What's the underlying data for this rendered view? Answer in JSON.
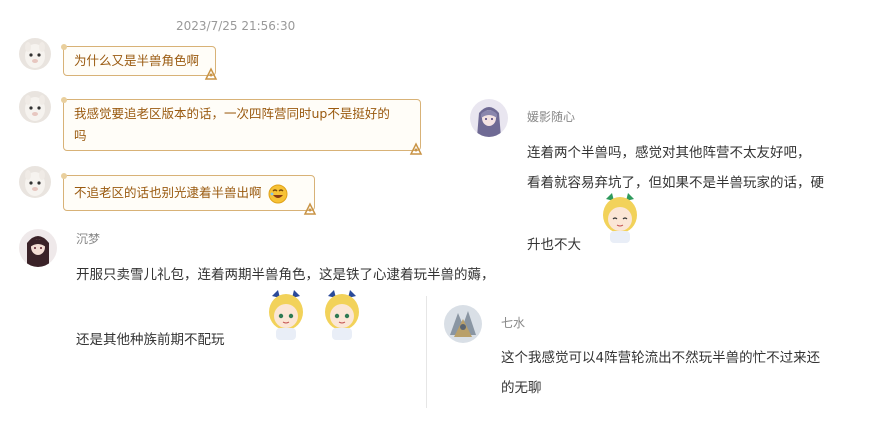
{
  "timestamp": "2023/7/25 21:56:30",
  "chat_bubbles": [
    {
      "text": "为什么又是半兽角色啊"
    },
    {
      "text_line1": "我感觉要追老区版本的话，一次四阵营同时up不是挺好的",
      "text_line2": "吗"
    },
    {
      "text": "不追老区的话也别光逮着半兽出啊"
    }
  ],
  "comments": [
    {
      "username": "沉梦",
      "line1": "开服只卖雪儿礼包，连着两期半兽角色，这是铁了心逮着玩半兽的薅，",
      "line2": "还是其他种族前期不配玩"
    },
    {
      "username": "媛影随心",
      "line1": "连着两个半兽吗，感觉对其他阵营不太友好吧，",
      "line2": "看着就容易弃坑了，但如果不是半兽玩家的话，硬",
      "line3": "升也不大"
    },
    {
      "username": "七水",
      "line1": "这个我感觉可以4阵营轮流出不然玩半兽的忙不过来还",
      "line2": "的无聊"
    }
  ],
  "colors": {
    "bubble_border": "#d8b277",
    "bubble_text": "#9a5a10",
    "username": "#888888",
    "body_text": "#333333",
    "timestamp": "#999999"
  }
}
